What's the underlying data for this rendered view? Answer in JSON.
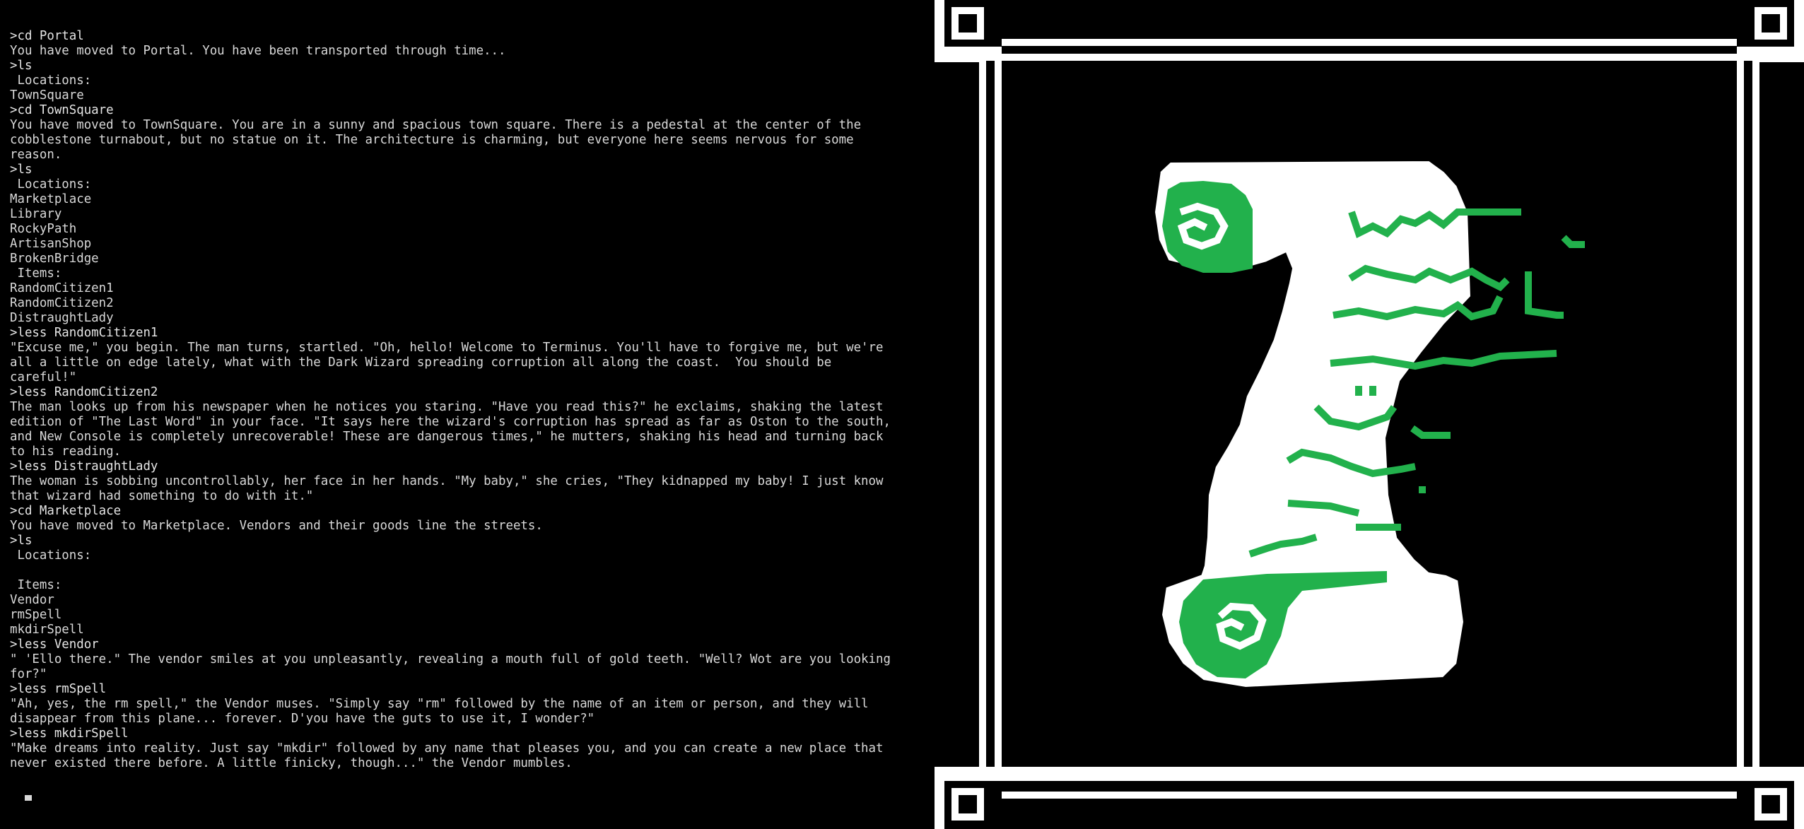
{
  "terminal": {
    "lines": [
      {
        "kind": "cmd",
        "text": ">cd Portal"
      },
      {
        "kind": "out",
        "text": "You have moved to Portal. You have been transported through time..."
      },
      {
        "kind": "cmd",
        "text": ">ls"
      },
      {
        "kind": "out",
        "text": " Locations:"
      },
      {
        "kind": "out",
        "text": "TownSquare"
      },
      {
        "kind": "cmd",
        "text": ">cd TownSquare"
      },
      {
        "kind": "out",
        "text": "You have moved to TownSquare. You are in a sunny and spacious town square. There is a pedestal at the center of the"
      },
      {
        "kind": "out",
        "text": "cobblestone turnabout, but no statue on it. The architecture is charming, but everyone here seems nervous for some"
      },
      {
        "kind": "out",
        "text": "reason."
      },
      {
        "kind": "cmd",
        "text": ">ls"
      },
      {
        "kind": "out",
        "text": " Locations:"
      },
      {
        "kind": "out",
        "text": "Marketplace"
      },
      {
        "kind": "out",
        "text": "Library"
      },
      {
        "kind": "out",
        "text": "RockyPath"
      },
      {
        "kind": "out",
        "text": "ArtisanShop"
      },
      {
        "kind": "out",
        "text": "BrokenBridge"
      },
      {
        "kind": "out",
        "text": " Items:"
      },
      {
        "kind": "out",
        "text": "RandomCitizen1"
      },
      {
        "kind": "out",
        "text": "RandomCitizen2"
      },
      {
        "kind": "out",
        "text": "DistraughtLady"
      },
      {
        "kind": "cmd",
        "text": ">less RandomCitizen1"
      },
      {
        "kind": "out",
        "text": "\"Excuse me,\" you begin. The man turns, startled. \"Oh, hello! Welcome to Terminus. You'll have to forgive me, but we're"
      },
      {
        "kind": "out",
        "text": "all a little on edge lately, what with the Dark Wizard spreading corruption all along the coast.  You should be"
      },
      {
        "kind": "out",
        "text": "careful!\""
      },
      {
        "kind": "cmd",
        "text": ">less RandomCitizen2"
      },
      {
        "kind": "out",
        "text": "The man looks up from his newspaper when he notices you staring. \"Have you read this?\" he exclaims, shaking the latest"
      },
      {
        "kind": "out",
        "text": "edition of \"The Last Word\" in your face. \"It says here the wizard's corruption has spread as far as Oston to the south,"
      },
      {
        "kind": "out",
        "text": "and New Console is completely unrecoverable! These are dangerous times,\" he mutters, shaking his head and turning back"
      },
      {
        "kind": "out",
        "text": "to his reading."
      },
      {
        "kind": "cmd",
        "text": ">less DistraughtLady"
      },
      {
        "kind": "out",
        "text": "The woman is sobbing uncontrollably, her face in her hands. \"My baby,\" she cries, \"They kidnapped my baby! I just know"
      },
      {
        "kind": "out",
        "text": "that wizard had something to do with it.\""
      },
      {
        "kind": "cmd",
        "text": ">cd Marketplace"
      },
      {
        "kind": "out",
        "text": "You have moved to Marketplace. Vendors and their goods line the streets."
      },
      {
        "kind": "cmd",
        "text": ">ls"
      },
      {
        "kind": "out",
        "text": " Locations:"
      },
      {
        "kind": "blank",
        "text": ""
      },
      {
        "kind": "out",
        "text": " Items:"
      },
      {
        "kind": "out",
        "text": "Vendor"
      },
      {
        "kind": "out",
        "text": "rmSpell"
      },
      {
        "kind": "out",
        "text": "mkdirSpell"
      },
      {
        "kind": "cmd",
        "text": ">less Vendor"
      },
      {
        "kind": "out",
        "text": "\" 'Ello there.\" The vendor smiles at you unpleasantly, revealing a mouth full of gold teeth. \"Well? Wot are you looking"
      },
      {
        "kind": "out",
        "text": "for?\""
      },
      {
        "kind": "cmd",
        "text": ">less rmSpell"
      },
      {
        "kind": "out",
        "text": "\"Ah, yes, the rm spell,\" the Vendor muses. \"Simply say \"rm\" followed by the name of an item or person, and they will"
      },
      {
        "kind": "out",
        "text": "disappear from this plane... forever. D'you have the guts to use it, I wonder?\""
      },
      {
        "kind": "cmd",
        "text": ">less mkdirSpell"
      },
      {
        "kind": "out",
        "text": "\"Make dreams into reality. Just say \"mkdir\" followed by any name that pleases you, and you can create a new place that"
      },
      {
        "kind": "out",
        "text": "never existed there before. A little finicky, though...\" the Vendor mumbles."
      }
    ]
  },
  "art": {
    "name": "scroll-item-image",
    "colors": {
      "background": "#000000",
      "frame": "#ffffff",
      "scroll": "#ffffff",
      "ink": "#22b14c",
      "outline": "#000000"
    }
  }
}
